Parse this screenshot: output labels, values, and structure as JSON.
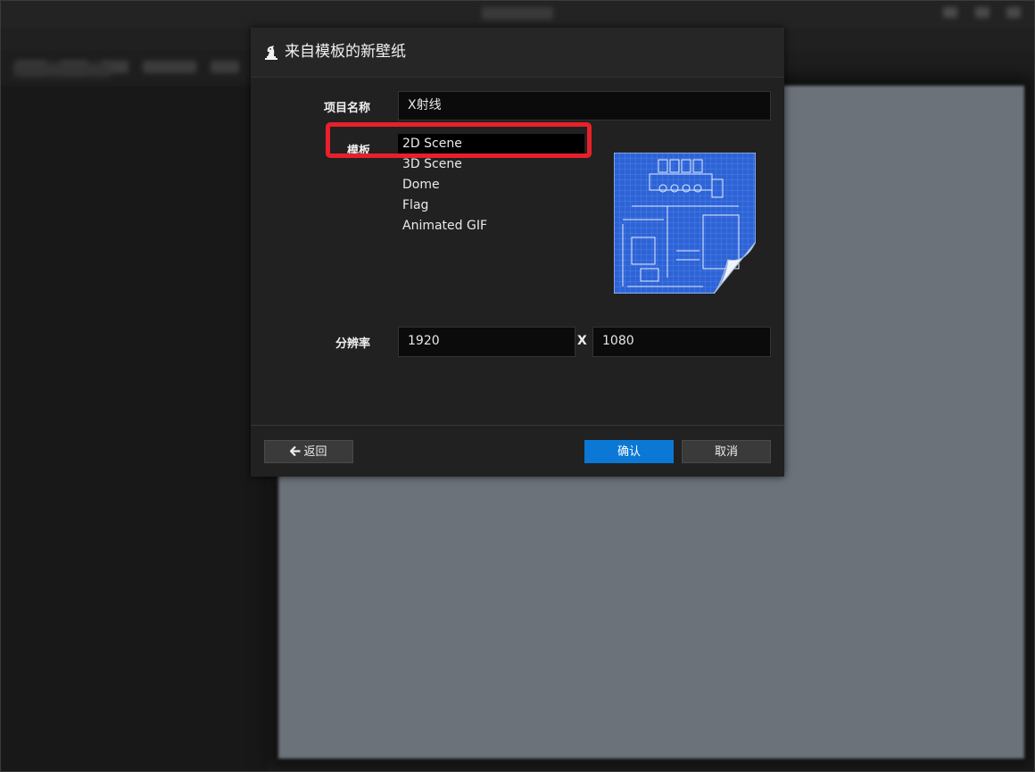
{
  "dialog": {
    "title": "来自模板的新壁纸",
    "icon": "chess-knight-icon"
  },
  "form": {
    "project_name_label": "项目名称",
    "project_name_value": "X射线",
    "template_label": "模板",
    "templates": [
      "2D Scene",
      "3D Scene",
      "Dome",
      "Flag",
      "Animated GIF"
    ],
    "selected_template": "2D Scene",
    "resolution_label": "分辨率",
    "resolution_width": "1920",
    "resolution_separator": "X",
    "resolution_height": "1080"
  },
  "buttons": {
    "back_icon": "arrow-left-icon",
    "back_label": "返回",
    "confirm_label": "确认",
    "cancel_label": "取消"
  },
  "colors": {
    "highlight": "#e8202a",
    "primary": "#0a78d4"
  }
}
